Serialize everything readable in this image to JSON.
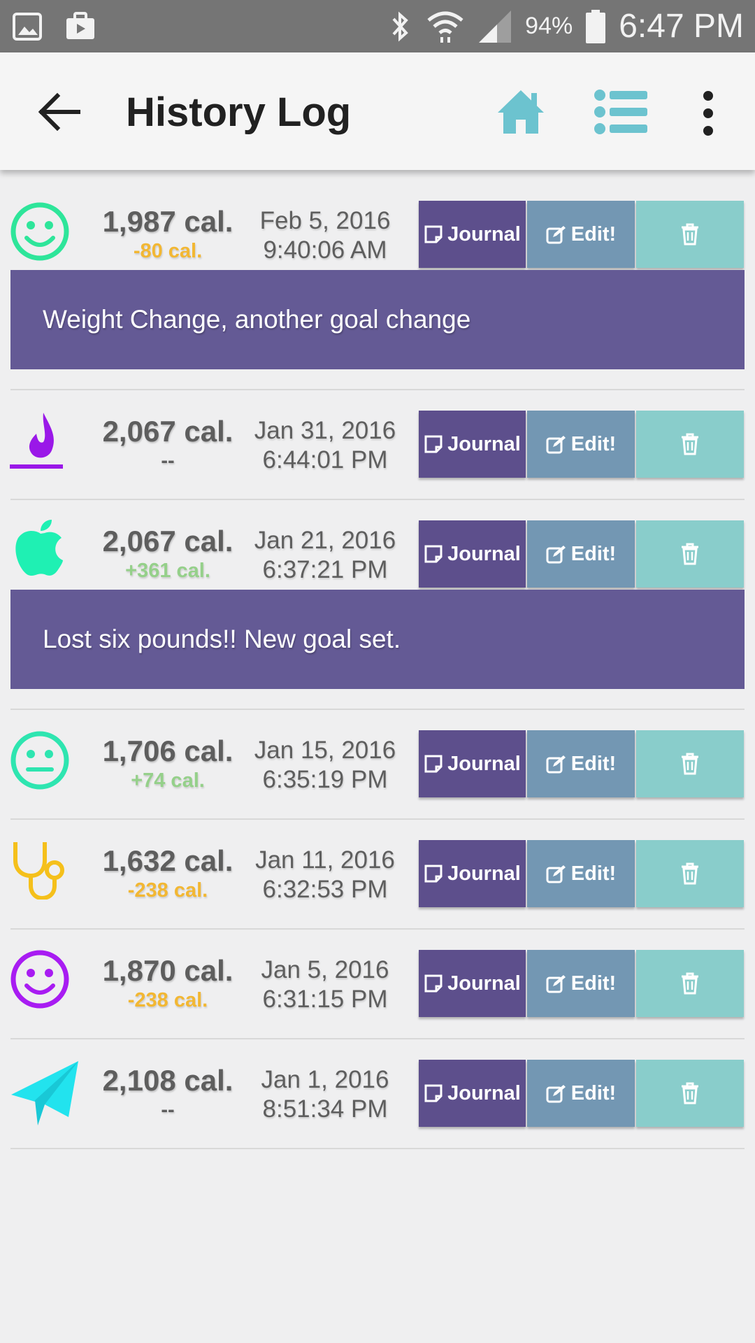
{
  "status_bar": {
    "battery": "94%",
    "time": "6:47 PM"
  },
  "app_bar": {
    "title": "History Log"
  },
  "buttons": {
    "journal_label": "Journal",
    "edit_label": "Edit!"
  },
  "entries": [
    {
      "icon": "smiley-outline-green-icon",
      "calories": "1,987 cal.",
      "delta": "-80 cal.",
      "date": "Feb 5, 2016",
      "time": "9:40:06 AM",
      "note": "Weight Change, another goal change"
    },
    {
      "icon": "purple-flame-icon",
      "calories": "2,067 cal.",
      "delta": "--",
      "date": "Jan 31, 2016",
      "time": "6:44:01 PM",
      "note": ""
    },
    {
      "icon": "apple-icon",
      "calories": "2,067 cal.",
      "delta": "+361 cal.",
      "date": "Jan 21, 2016",
      "time": "6:37:21 PM",
      "note": "Lost six pounds!!  New goal set."
    },
    {
      "icon": "neutral-face-icon",
      "calories": "1,706 cal.",
      "delta": "+74 cal.",
      "date": "Jan 15, 2016",
      "time": "6:35:19 PM",
      "note": ""
    },
    {
      "icon": "stethoscope-icon",
      "calories": "1,632 cal.",
      "delta": "-238 cal.",
      "date": "Jan 11, 2016",
      "time": "6:32:53 PM",
      "note": ""
    },
    {
      "icon": "smiley-purple-icon",
      "calories": "1,870 cal.",
      "delta": "-238 cal.",
      "date": "Jan 5, 2016",
      "time": "6:31:15 PM",
      "note": ""
    },
    {
      "icon": "paper-plane-icon",
      "calories": "2,108 cal.",
      "delta": "--",
      "date": "Jan 1, 2016",
      "time": "8:51:34 PM",
      "note": ""
    }
  ],
  "colors": {
    "accent_teal": "#6cc3cf",
    "journal": "#5d4f8c",
    "edit": "#7397b3",
    "delete": "#89cdcb",
    "note_bg": "#645a95",
    "delta_negative": "#f2b733",
    "delta_positive": "#95d08a"
  }
}
